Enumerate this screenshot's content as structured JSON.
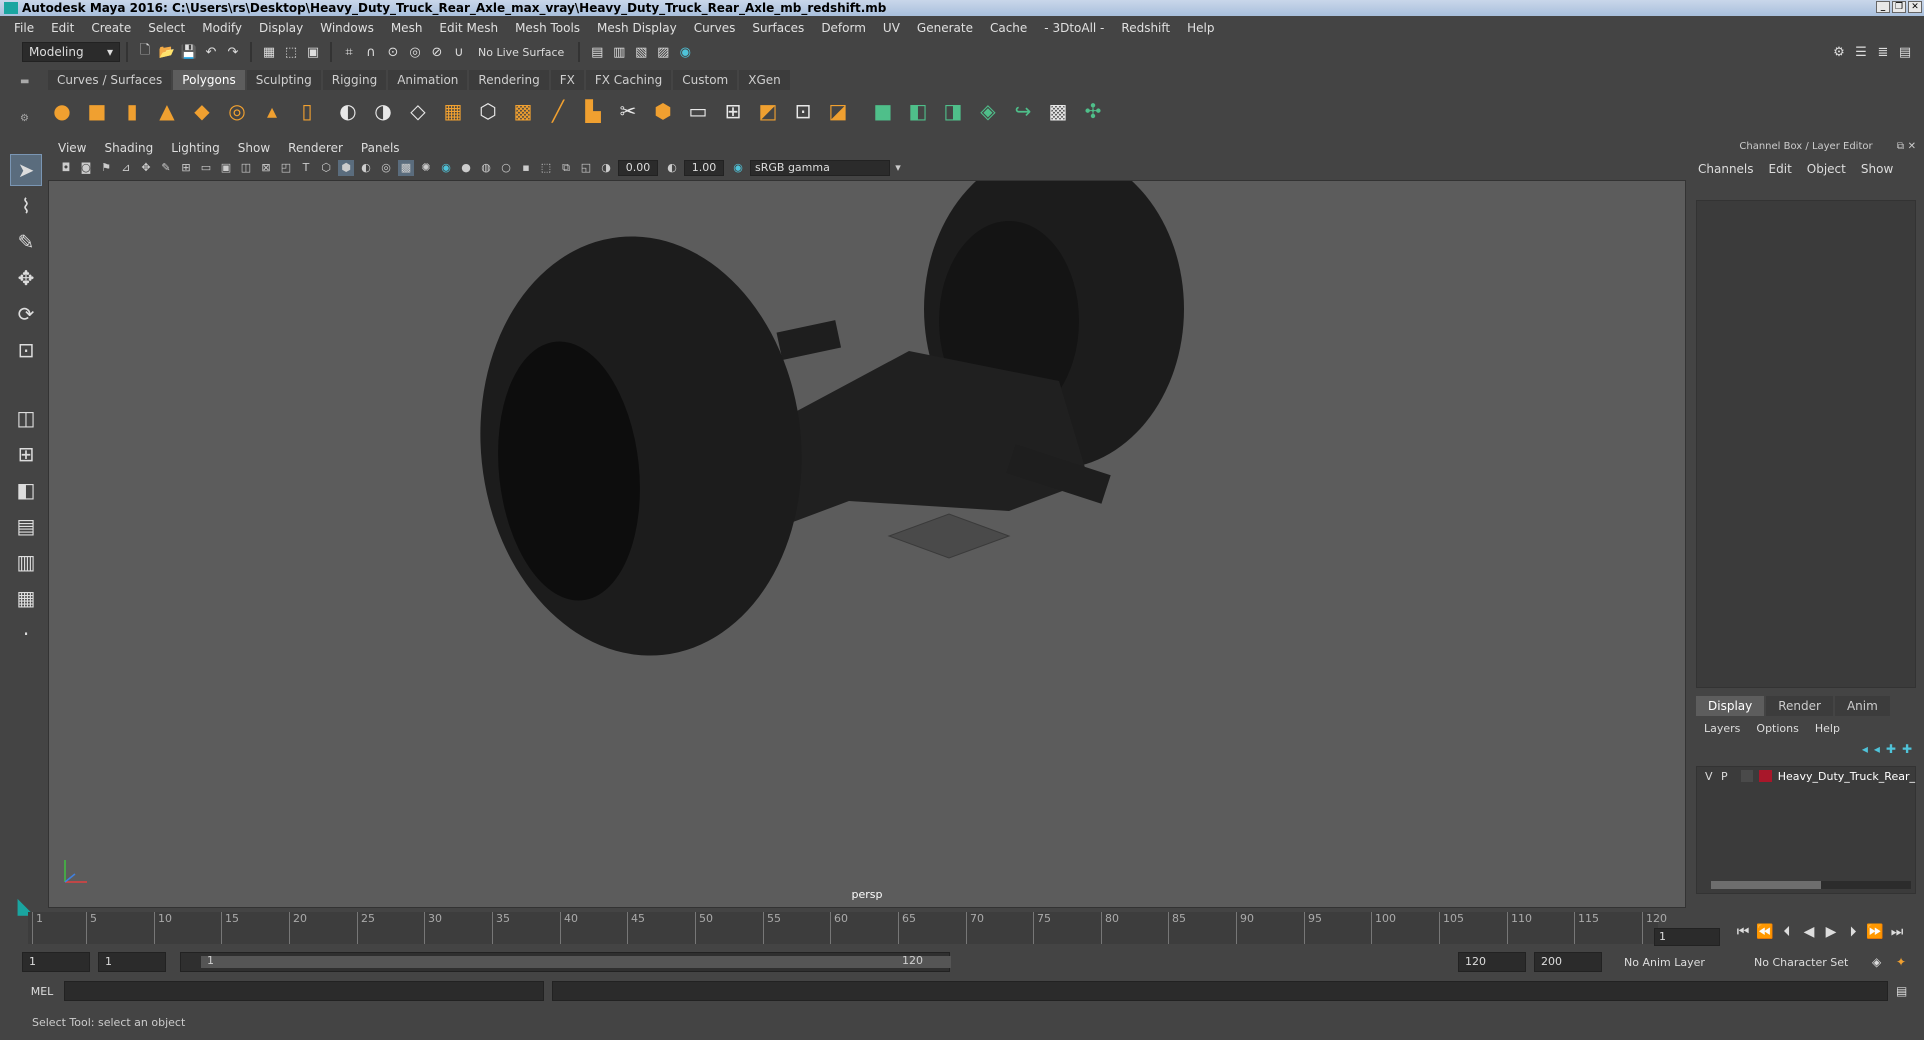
{
  "window": {
    "title": "Autodesk Maya 2016: C:\\Users\\rs\\Desktop\\Heavy_Duty_Truck_Rear_Axle_max_vray\\Heavy_Duty_Truck_Rear_Axle_mb_redshift.mb"
  },
  "menubar": {
    "items": [
      "File",
      "Edit",
      "Create",
      "Select",
      "Modify",
      "Display",
      "Windows",
      "Mesh",
      "Edit Mesh",
      "Mesh Tools",
      "Mesh Display",
      "Curves",
      "Surfaces",
      "Deform",
      "UV",
      "Generate",
      "Cache",
      "- 3DtoAll -",
      "Redshift",
      "Help"
    ]
  },
  "statusline": {
    "mode": "Modeling",
    "live_surface": "No Live Surface"
  },
  "shelf": {
    "tabs": [
      "Curves / Surfaces",
      "Polygons",
      "Sculpting",
      "Rigging",
      "Animation",
      "Rendering",
      "FX",
      "FX Caching",
      "Custom",
      "XGen"
    ],
    "active_tab": "Polygons"
  },
  "viewport": {
    "menu": [
      "View",
      "Shading",
      "Lighting",
      "Show",
      "Renderer",
      "Panels"
    ],
    "exposure": "0.00",
    "gamma": "1.00",
    "color_space": "sRGB gamma",
    "camera_label": "persp"
  },
  "channel_box": {
    "title": "Channel Box / Layer Editor",
    "menu": [
      "Channels",
      "Edit",
      "Object",
      "Show"
    ],
    "layer_tabs": [
      "Display",
      "Render",
      "Anim"
    ],
    "active_layer_tab": "Display",
    "layer_menu": [
      "Layers",
      "Options",
      "Help"
    ],
    "layer": {
      "v": "V",
      "p": "P",
      "name": "Heavy_Duty_Truck_Rear_",
      "color": "#a8172a"
    }
  },
  "timeline": {
    "ticks": [
      "1",
      "5",
      "10",
      "15",
      "20",
      "25",
      "30",
      "35",
      "40",
      "45",
      "50",
      "55",
      "60",
      "65",
      "70",
      "75",
      "80",
      "85",
      "90",
      "95",
      "100",
      "105",
      "110",
      "115",
      "120"
    ],
    "current_frame": "1"
  },
  "range": {
    "start": "1",
    "playback_start": "1",
    "slider_start": "1",
    "slider_end": "120",
    "playback_end": "120",
    "end": "200",
    "anim_layer": "No Anim Layer",
    "character_set": "No Character Set"
  },
  "command_line": {
    "label": "MEL"
  },
  "help_line": {
    "text": "Select Tool: select an object"
  }
}
